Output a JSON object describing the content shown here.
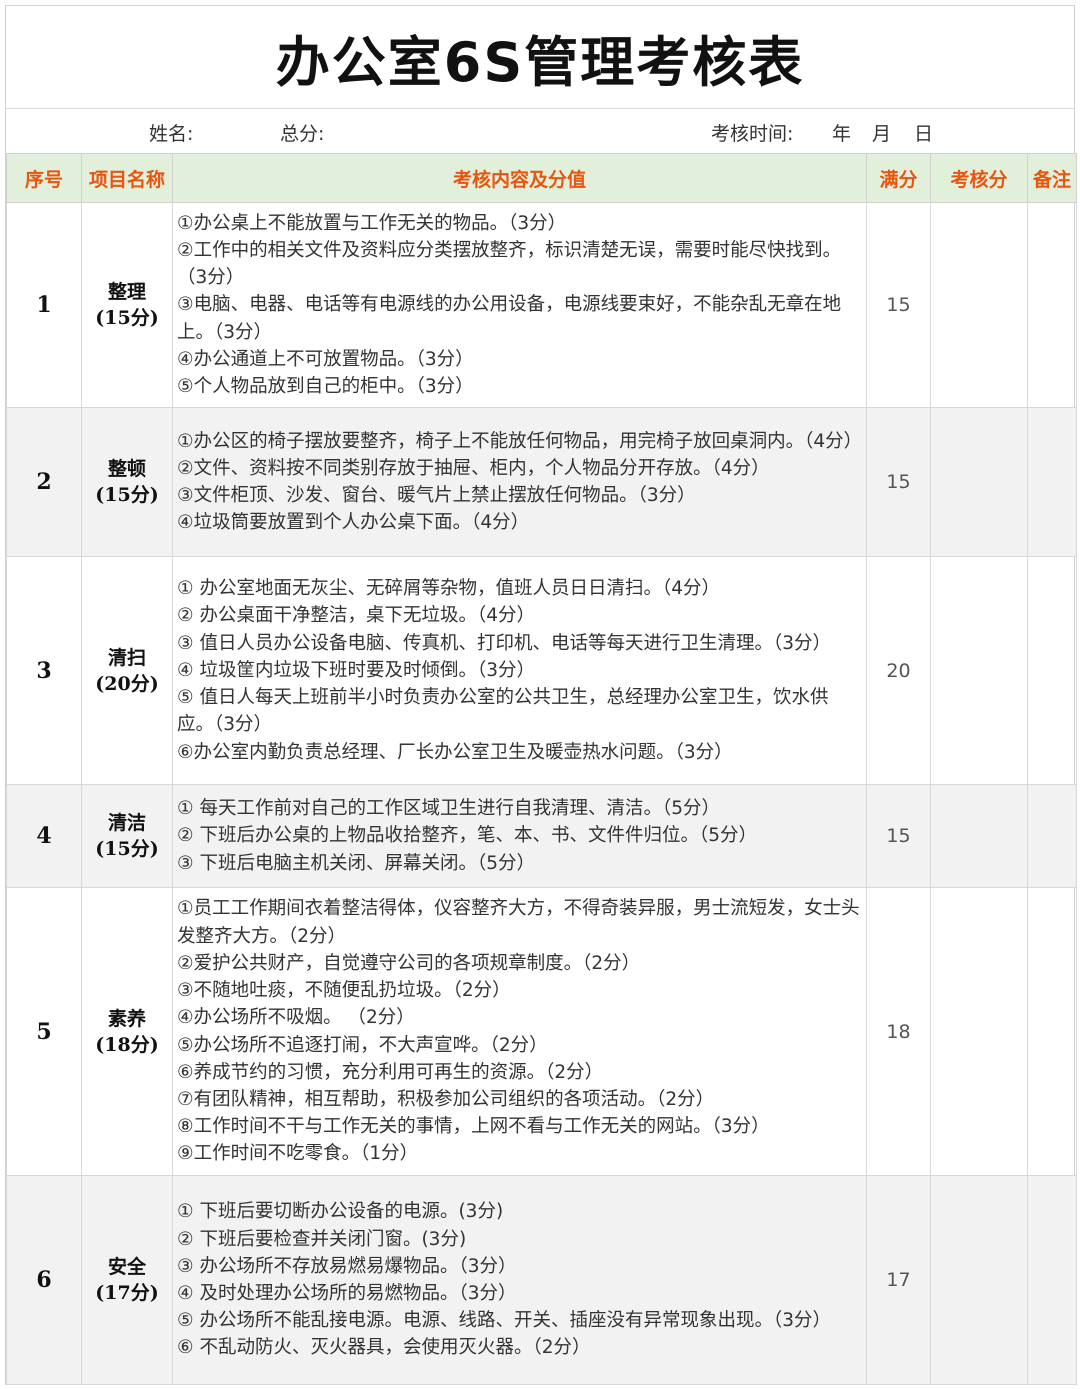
{
  "title": "办公室6S管理考核表",
  "info": {
    "name_label": "姓名:",
    "total_label": "总分:",
    "time_label": "考核时间:",
    "year": "年",
    "month": "月",
    "day": "日"
  },
  "headers": {
    "index": "序号",
    "item": "项目名称",
    "content": "考核内容及分值",
    "full_score": "满分",
    "score": "考核分",
    "remark": "备注"
  },
  "rows": [
    {
      "index": "1",
      "name": "整理",
      "points": "(15分)",
      "full": "15",
      "items": [
        "①办公桌上不能放置与工作无关的物品。（3分）",
        "②工作中的相关文件及资料应分类摆放整齐，标识清楚无误，需要时能尽快找到。（3分）",
        "③电脑、电器、电话等有电源线的办公用设备，电源线要束好，不能杂乱无章在地上。（3分）",
        "④办公通道上不可放置物品。（3分）",
        "⑤个人物品放到自己的柜中。（3分）"
      ]
    },
    {
      "index": "2",
      "name": "整顿",
      "points": "(15分)",
      "full": "15",
      "items": [
        "①办公区的椅子摆放要整齐，椅子上不能放任何物品，用完椅子放回桌洞内。（4分）",
        "②文件、资料按不同类别存放于抽屉、柜内，个人物品分开存放。（4分）",
        "③文件柜顶、沙发、窗台、暖气片上禁止摆放任何物品。（3分）",
        "④垃圾筒要放置到个人办公桌下面。（4分）"
      ]
    },
    {
      "index": "3",
      "name": "清扫",
      "points": "(20分)",
      "full": "20",
      "items": [
        "① 办公室地面无灰尘、无碎屑等杂物，值班人员日日清扫。（4分）",
        "② 办公桌面干净整洁，桌下无垃圾。（4分）",
        "③ 值日人员办公设备电脑、传真机、打印机、电话等每天进行卫生清理。（3分）",
        "④ 垃圾筐内垃圾下班时要及时倾倒。（3分）",
        "⑤ 值日人每天上班前半小时负责办公室的公共卫生，总经理办公室卫生，饮水供应。（3分）",
        "⑥办公室内勤负责总经理、厂长办公室卫生及暖壶热水问题。（3分）"
      ]
    },
    {
      "index": "4",
      "name": "清洁",
      "points": "(15分)",
      "full": "15",
      "items": [
        "① 每天工作前对自己的工作区域卫生进行自我清理、清洁。（5分）",
        "② 下班后办公桌的上物品收拾整齐，笔、本、书、文件件归位。（5分）",
        "③ 下班后电脑主机关闭、屏幕关闭。（5分）"
      ]
    },
    {
      "index": "5",
      "name": "素养",
      "points": "(18分)",
      "full": "18",
      "items": [
        "①员工工作期间衣着整洁得体，仪容整齐大方，不得奇装异服，男士流短发，女士头发整齐大方。（2分）",
        "②爱护公共财产，自觉遵守公司的各项规章制度。（2分）",
        "③不随地吐痰，不随便乱扔垃圾。（2分）",
        "④办公场所不吸烟。 （2分）",
        "⑤办公场所不追逐打闹，不大声宣哗。（2分）",
        "⑥养成节约的习惯，充分利用可再生的资源。（2分）",
        "⑦有团队精神，相互帮助，积极参加公司组织的各项活动。（2分）",
        "⑧工作时间不干与工作无关的事情，上网不看与工作无关的网站。（3分）",
        "⑨工作时间不吃零食。（1分）"
      ]
    },
    {
      "index": "6",
      "name": "安全",
      "points": "(17分)",
      "full": "17",
      "items": [
        "① 下班后要切断办公设备的电源。(3分)",
        "② 下班后要检查并关闭门窗。(3分)",
        "③ 办公场所不存放易燃易爆物品。（3分）",
        "④ 及时处理办公场所的易燃物品。（3分）",
        "⑤ 办公场所不能乱接电源。电源、线路、开关、插座没有异常现象出现。（3分）",
        "⑥ 不乱动防火、灭火器具，会使用灭火器。（2分）"
      ]
    }
  ]
}
